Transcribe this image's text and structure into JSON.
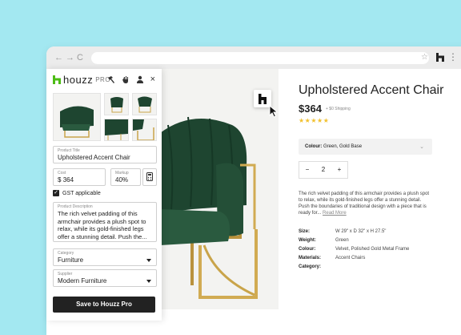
{
  "browser": {
    "back": "←",
    "forward": "→",
    "reload": "C",
    "star": "☆",
    "menu": "⋮"
  },
  "panel": {
    "brand": "houzz",
    "brand_tier": "PRO",
    "brand_color": "#4DBC15",
    "header_icons": [
      "hammer-icon",
      "hand-icon",
      "user-icon",
      "close-icon"
    ],
    "close_glyph": "×",
    "product_title_label": "Product Title",
    "product_title": "Upholstered Accent Chair",
    "cost_label": "Cost",
    "cost_currency": "$",
    "cost_value": "364",
    "markup_label": "Markup",
    "markup_value": "40%",
    "gst_label": "GST applicable",
    "gst_checked": true,
    "description_label": "Product Description",
    "description": "The rich velvet padding of this armchair provides a plush spot to relax, while its gold-finished legs offer a stunning detail. Push the...",
    "category_label": "Category",
    "category_value": "Furniture",
    "supplier_label": "Supplier",
    "supplier_value": "Modern Furniture",
    "save_button": "Save to Houzz Pro"
  },
  "product": {
    "title": "Upholstered Accent Chair",
    "price": "$364",
    "shipping": "+ $0 Shipping",
    "rating": 5,
    "stars": "★★★★★",
    "colour_label": "Colour:",
    "colour_value": "Green, Gold Base",
    "qty_minus": "−",
    "qty_value": "2",
    "qty_plus": "+",
    "description": "The rich velvet padding of this armchair provides a plush spot to relax, while its gold-finished legs offer a stunning detail. Push the boundaries of traditional design with a piece that is ready for...",
    "read_more": "Read More",
    "specs": [
      {
        "key": "Size:",
        "value": "W 29\" x D 32\" x H 27.5\""
      },
      {
        "key": "Weight:",
        "value": "Green"
      },
      {
        "key": "Colour:",
        "value": "Velvet, Polished Gold Metal Frame"
      },
      {
        "key": "Materials:",
        "value": "Accent Chairs"
      },
      {
        "key": "Category:",
        "value": ""
      }
    ]
  },
  "colors": {
    "background": "#A3E8F1",
    "velvet": "#1F4A33",
    "gold": "#C9A44A",
    "button": "#222222"
  }
}
